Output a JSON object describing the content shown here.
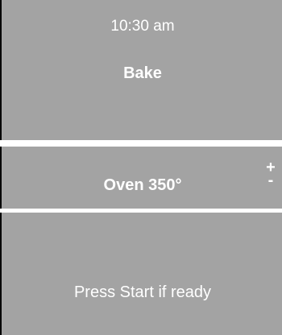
{
  "display": {
    "time": "10:30 am",
    "mode": "Bake"
  },
  "temperature": {
    "label": "Oven 350°",
    "increase_symbol": "+",
    "decrease_symbol": "-"
  },
  "prompt": {
    "message": "Press Start if ready"
  },
  "colors": {
    "panel_background": "#a3a3a3",
    "text": "#ffffff",
    "divider": "#ffffff"
  }
}
